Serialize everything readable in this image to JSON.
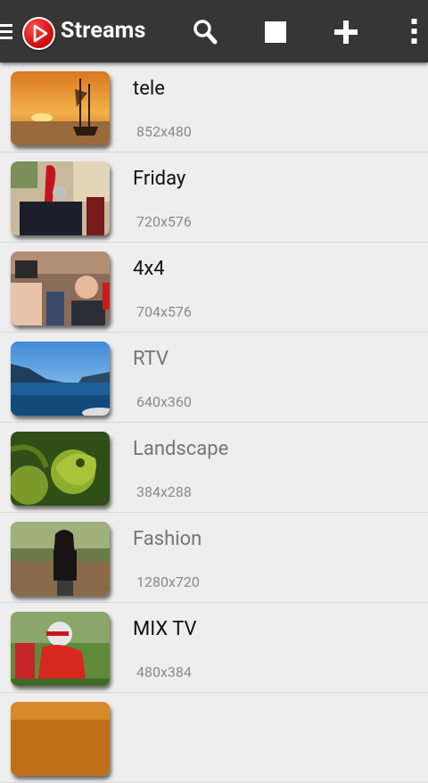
{
  "app": {
    "title": "Streams",
    "icons": {
      "menu": "hamburger-menu-icon",
      "logo": "play-logo-icon",
      "search": "search-icon",
      "stop": "stop-icon",
      "add": "plus-icon",
      "more": "more-vertical-icon"
    },
    "colors": {
      "appbar": "#363636",
      "background": "#eeeeee",
      "logo_red": "#d51212"
    }
  },
  "streams": [
    {
      "name": "tele",
      "resolution": "852x480",
      "name_color": "#111111",
      "thumb": "sunset-ship"
    },
    {
      "name": "Friday",
      "resolution": "720x576",
      "name_color": "#111111",
      "thumb": "guards-parade"
    },
    {
      "name": "4x4",
      "resolution": "704x576",
      "name_color": "#111111",
      "thumb": "press-crowd"
    },
    {
      "name": "RTV",
      "resolution": "640x360",
      "name_color": "#757575",
      "thumb": "lake-mountains"
    },
    {
      "name": "Landscape",
      "resolution": "384x288",
      "name_color": "#757575",
      "thumb": "chameleon"
    },
    {
      "name": "Fashion",
      "resolution": "1280x720",
      "name_color": "#757575",
      "thumb": "woman-park"
    },
    {
      "name": "MIX TV",
      "resolution": "480x384",
      "name_color": "#111111",
      "thumb": "football-player"
    }
  ]
}
